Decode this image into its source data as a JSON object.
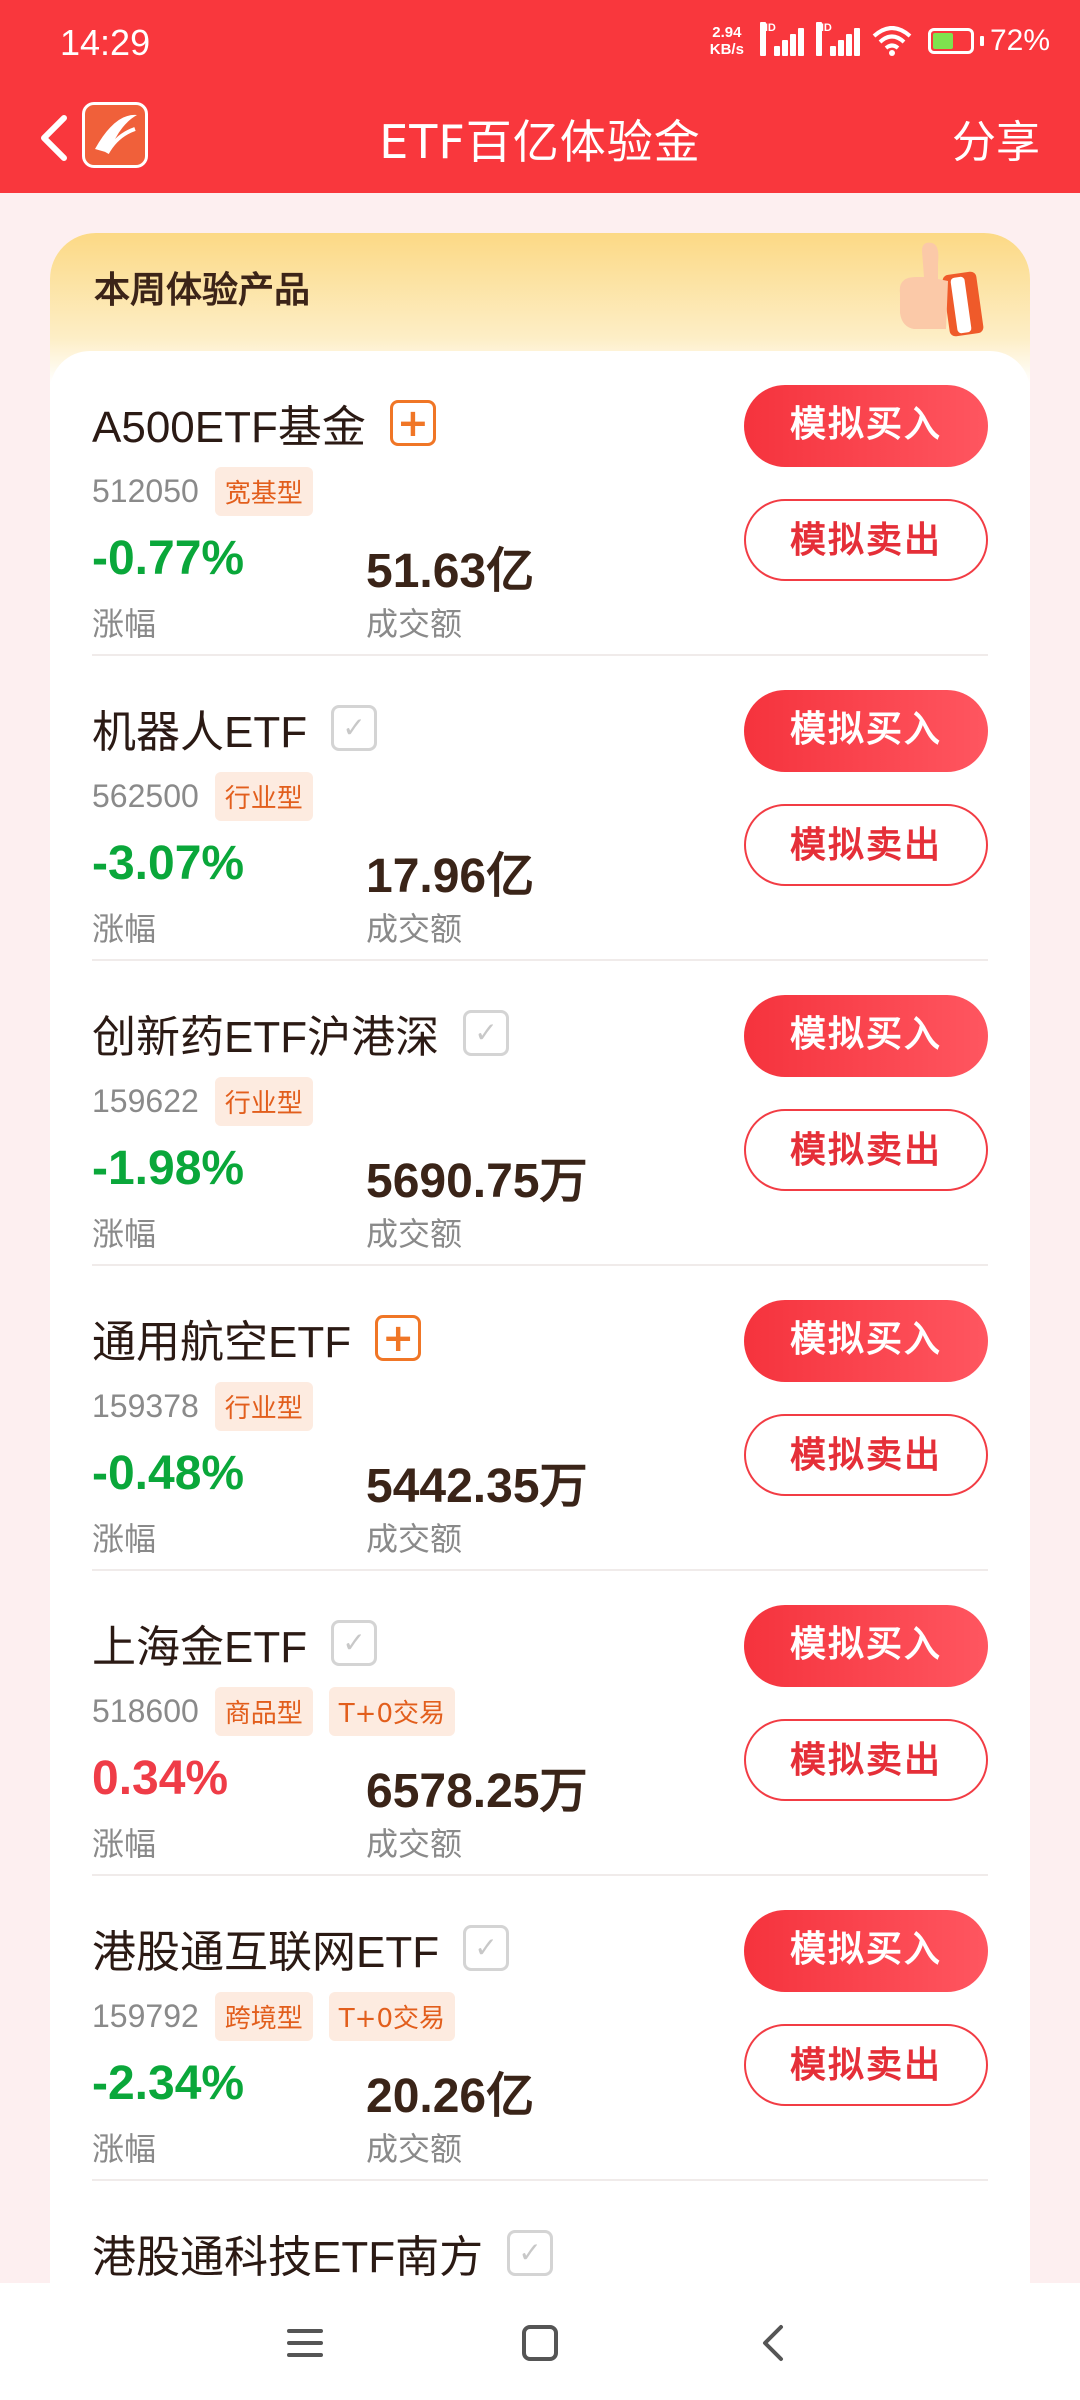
{
  "status_bar": {
    "time": "14:29",
    "net_speed_value": "2.94",
    "net_speed_unit": "KB/s",
    "signal_label": "HD",
    "battery": "72%"
  },
  "header": {
    "title": "ETF百亿体验金",
    "share_label": "分享"
  },
  "section": {
    "title": "本周体验产品"
  },
  "items": [
    {
      "name": "A500ETF基金",
      "added": false,
      "code": "512050",
      "tags": [
        "宽基型"
      ],
      "change": "-0.77%",
      "direction": "down",
      "change_label": "涨幅",
      "volume": "51.63亿",
      "volume_label": "成交额",
      "buy_label": "模拟买入",
      "sell_label": "模拟卖出"
    },
    {
      "name": "机器人ETF",
      "added": true,
      "code": "562500",
      "tags": [
        "行业型"
      ],
      "change": "-3.07%",
      "direction": "down",
      "change_label": "涨幅",
      "volume": "17.96亿",
      "volume_label": "成交额",
      "buy_label": "模拟买入",
      "sell_label": "模拟卖出"
    },
    {
      "name": "创新药ETF沪港深",
      "added": true,
      "code": "159622",
      "tags": [
        "行业型"
      ],
      "change": "-1.98%",
      "direction": "down",
      "change_label": "涨幅",
      "volume": "5690.75万",
      "volume_label": "成交额",
      "buy_label": "模拟买入",
      "sell_label": "模拟卖出"
    },
    {
      "name": "通用航空ETF",
      "added": false,
      "code": "159378",
      "tags": [
        "行业型"
      ],
      "change": "-0.48%",
      "direction": "down",
      "change_label": "涨幅",
      "volume": "5442.35万",
      "volume_label": "成交额",
      "buy_label": "模拟买入",
      "sell_label": "模拟卖出"
    },
    {
      "name": "上海金ETF",
      "added": true,
      "code": "518600",
      "tags": [
        "商品型",
        "T+0交易"
      ],
      "change": "0.34%",
      "direction": "up",
      "change_label": "涨幅",
      "volume": "6578.25万",
      "volume_label": "成交额",
      "buy_label": "模拟买入",
      "sell_label": "模拟卖出"
    },
    {
      "name": "港股通互联网ETF",
      "added": true,
      "code": "159792",
      "tags": [
        "跨境型",
        "T+0交易"
      ],
      "change": "-2.34%",
      "direction": "down",
      "change_label": "涨幅",
      "volume": "20.26亿",
      "volume_label": "成交额",
      "buy_label": "模拟买入",
      "sell_label": "模拟卖出"
    },
    {
      "name": "港股通科技ETF南方",
      "added": true,
      "code": "",
      "tags": [],
      "change": "",
      "direction": "down",
      "change_label": "",
      "volume": "",
      "volume_label": "",
      "buy_label": "",
      "sell_label": ""
    }
  ],
  "icons": {
    "back": "chevron-left-icon",
    "logo": "app-logo-icon",
    "add": "plus-square-icon",
    "added": "check-square-icon",
    "thumb": "thumbs-up-icon",
    "menu": "menu-icon",
    "home": "square-home-icon",
    "nav_back": "chevron-back-icon"
  },
  "colors": {
    "primary": "#f9373d",
    "down": "#0aa73a",
    "up": "#ef3c47",
    "tag": "#e25e1c"
  }
}
